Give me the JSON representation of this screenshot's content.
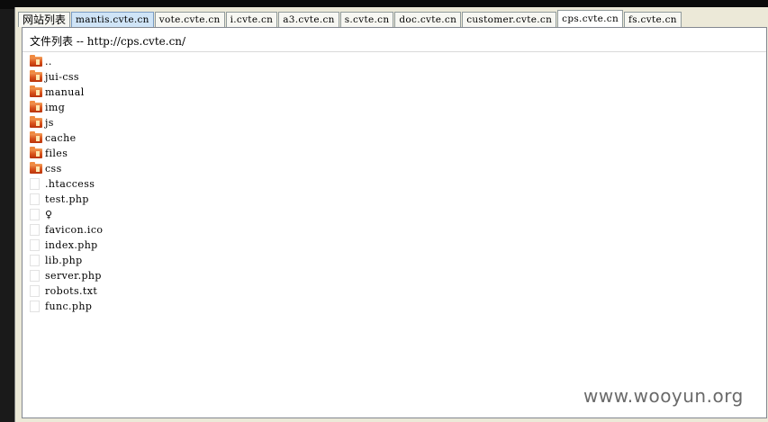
{
  "tabs": [
    {
      "label": "网站列表",
      "state": "normal"
    },
    {
      "label": "mantis.cvte.cn",
      "state": "highlight"
    },
    {
      "label": "vote.cvte.cn",
      "state": "normal"
    },
    {
      "label": "i.cvte.cn",
      "state": "normal"
    },
    {
      "label": "a3.cvte.cn",
      "state": "normal"
    },
    {
      "label": "s.cvte.cn",
      "state": "normal"
    },
    {
      "label": "doc.cvte.cn",
      "state": "normal"
    },
    {
      "label": "customer.cvte.cn",
      "state": "normal"
    },
    {
      "label": "cps.cvte.cn",
      "state": "selected"
    },
    {
      "label": "fs.cvte.cn",
      "state": "normal"
    }
  ],
  "header": {
    "label": "文件列表",
    "separator": "--",
    "url": "http://cps.cvte.cn/"
  },
  "files": [
    {
      "name": "..",
      "type": "folder"
    },
    {
      "name": "jui-css",
      "type": "folder"
    },
    {
      "name": "manual",
      "type": "folder"
    },
    {
      "name": "img",
      "type": "folder"
    },
    {
      "name": "js",
      "type": "folder"
    },
    {
      "name": "cache",
      "type": "folder"
    },
    {
      "name": "files",
      "type": "folder"
    },
    {
      "name": "css",
      "type": "folder"
    },
    {
      "name": ".htaccess",
      "type": "file"
    },
    {
      "name": "test.php",
      "type": "file"
    },
    {
      "name": "♀",
      "type": "file"
    },
    {
      "name": "favicon.ico",
      "type": "file"
    },
    {
      "name": "index.php",
      "type": "file"
    },
    {
      "name": "lib.php",
      "type": "file"
    },
    {
      "name": "server.php",
      "type": "file"
    },
    {
      "name": "robots.txt",
      "type": "file"
    },
    {
      "name": "func.php",
      "type": "file"
    }
  ],
  "watermark": "www.wooyun.org"
}
